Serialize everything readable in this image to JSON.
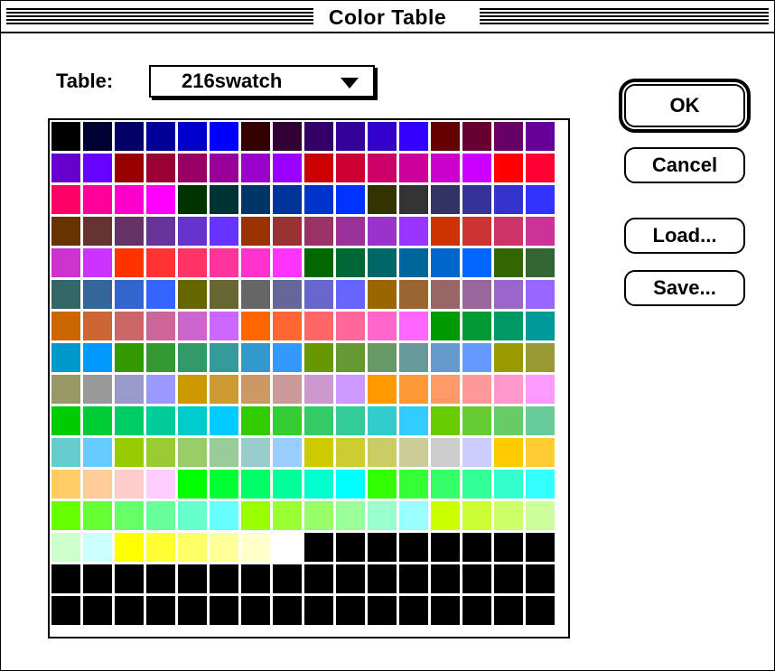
{
  "window": {
    "title": "Color Table"
  },
  "table_label": "Table:",
  "table_select": {
    "value": "216swatch"
  },
  "buttons": {
    "ok": "OK",
    "cancel": "Cancel",
    "load": "Load...",
    "save": "Save..."
  },
  "swatch_colors": [
    "#000000",
    "#000033",
    "#000066",
    "#000099",
    "#0000CC",
    "#0000FF",
    "#330000",
    "#330033",
    "#330066",
    "#330099",
    "#3300CC",
    "#3300FF",
    "#660000",
    "#660033",
    "#660066",
    "#660099",
    "#6600CC",
    "#6600FF",
    "#990000",
    "#990033",
    "#990066",
    "#990099",
    "#9900CC",
    "#9900FF",
    "#CC0000",
    "#CC0033",
    "#CC0066",
    "#CC0099",
    "#CC00CC",
    "#CC00FF",
    "#FF0000",
    "#FF0033",
    "#FF0066",
    "#FF0099",
    "#FF00CC",
    "#FF00FF",
    "#003300",
    "#003333",
    "#003366",
    "#003399",
    "#0033CC",
    "#0033FF",
    "#333300",
    "#333333",
    "#333366",
    "#333399",
    "#3333CC",
    "#3333FF",
    "#663300",
    "#663333",
    "#663366",
    "#663399",
    "#6633CC",
    "#6633FF",
    "#993300",
    "#993333",
    "#993366",
    "#993399",
    "#9933CC",
    "#9933FF",
    "#CC3300",
    "#CC3333",
    "#CC3366",
    "#CC3399",
    "#CC33CC",
    "#CC33FF",
    "#FF3300",
    "#FF3333",
    "#FF3366",
    "#FF3399",
    "#FF33CC",
    "#FF33FF",
    "#006600",
    "#006633",
    "#006666",
    "#006699",
    "#0066CC",
    "#0066FF",
    "#336600",
    "#336633",
    "#336666",
    "#336699",
    "#3366CC",
    "#3366FF",
    "#666600",
    "#666633",
    "#666666",
    "#666699",
    "#6666CC",
    "#6666FF",
    "#996600",
    "#996633",
    "#996666",
    "#996699",
    "#9966CC",
    "#9966FF",
    "#CC6600",
    "#CC6633",
    "#CC6666",
    "#CC6699",
    "#CC66CC",
    "#CC66FF",
    "#FF6600",
    "#FF6633",
    "#FF6666",
    "#FF6699",
    "#FF66CC",
    "#FF66FF",
    "#009900",
    "#009933",
    "#009966",
    "#009999",
    "#0099CC",
    "#0099FF",
    "#339900",
    "#339933",
    "#339966",
    "#339999",
    "#3399CC",
    "#3399FF",
    "#669900",
    "#669933",
    "#669966",
    "#669999",
    "#6699CC",
    "#6699FF",
    "#999900",
    "#999933",
    "#999966",
    "#999999",
    "#9999CC",
    "#9999FF",
    "#CC9900",
    "#CC9933",
    "#CC9966",
    "#CC9999",
    "#CC99CC",
    "#CC99FF",
    "#FF9900",
    "#FF9933",
    "#FF9966",
    "#FF9999",
    "#FF99CC",
    "#FF99FF",
    "#00CC00",
    "#00CC33",
    "#00CC66",
    "#00CC99",
    "#00CCCC",
    "#00CCFF",
    "#33CC00",
    "#33CC33",
    "#33CC66",
    "#33CC99",
    "#33CCCC",
    "#33CCFF",
    "#66CC00",
    "#66CC33",
    "#66CC66",
    "#66CC99",
    "#66CCCC",
    "#66CCFF",
    "#99CC00",
    "#99CC33",
    "#99CC66",
    "#99CC99",
    "#99CCCC",
    "#99CCFF",
    "#CCCC00",
    "#CCCC33",
    "#CCCC66",
    "#CCCC99",
    "#CCCCCC",
    "#CCCCFF",
    "#FFCC00",
    "#FFCC33",
    "#FFCC66",
    "#FFCC99",
    "#FFCCCC",
    "#FFCCFF",
    "#00FF00",
    "#00FF33",
    "#00FF66",
    "#00FF99",
    "#00FFCC",
    "#00FFFF",
    "#33FF00",
    "#33FF33",
    "#33FF66",
    "#33FF99",
    "#33FFCC",
    "#33FFFF",
    "#66FF00",
    "#66FF33",
    "#66FF66",
    "#66FF99",
    "#66FFCC",
    "#66FFFF",
    "#99FF00",
    "#99FF33",
    "#99FF66",
    "#99FF99",
    "#99FFCC",
    "#99FFFF",
    "#CCFF00",
    "#CCFF33",
    "#CCFF66",
    "#CCFF99",
    "#CCFFCC",
    "#CCFFFF",
    "#FFFF00",
    "#FFFF33",
    "#FFFF66",
    "#FFFF99",
    "#FFFFCC",
    "#FFFFFF",
    "#000000",
    "#000000",
    "#000000",
    "#000000",
    "#000000",
    "#000000",
    "#000000",
    "#000000",
    "#000000",
    "#000000",
    "#000000",
    "#000000",
    "#000000",
    "#000000",
    "#000000",
    "#000000",
    "#000000",
    "#000000",
    "#000000",
    "#000000",
    "#000000",
    "#000000",
    "#000000",
    "#000000",
    "#000000",
    "#000000",
    "#000000",
    "#000000",
    "#000000",
    "#000000",
    "#000000",
    "#000000",
    "#000000",
    "#000000",
    "#000000",
    "#000000",
    "#000000",
    "#000000",
    "#000000",
    "#000000"
  ]
}
